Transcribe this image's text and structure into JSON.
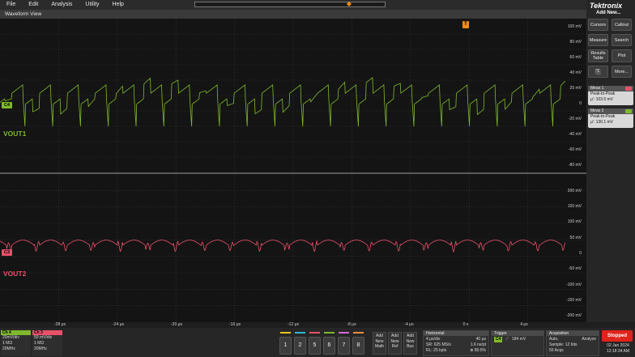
{
  "menu": [
    "File",
    "Edit",
    "Analysis",
    "Utility",
    "Help"
  ],
  "waveform_view_title": "Waveform View",
  "trigger_marker": "T",
  "brand": "Tektronix",
  "add_new": "Add New...",
  "panel_buttons": [
    "Cursors",
    "Callout",
    "Measure",
    "Search",
    "Results Table",
    "Plot",
    "More..."
  ],
  "measurements": [
    {
      "title": "Meas 1",
      "type": "Peak-to-Peak",
      "value": "μ': 103.5 mV",
      "color": "#e8516a"
    },
    {
      "title": "Meas 2",
      "type": "Peak-to-Peak",
      "value": "μ': 130.1 mV",
      "color": "#7fb92d"
    }
  ],
  "channels": {
    "vout1": {
      "badge": "C4",
      "name": "VOUT1",
      "color": "#7fb92d"
    },
    "vout2": {
      "badge": "C3",
      "name": "VOUT2",
      "color": "#e8516a"
    }
  },
  "top_axis_labels": [
    "100 mV",
    "80 mV",
    "60 mV",
    "40 mV",
    "20 mV",
    "0",
    "-20 mV",
    "-40 mV",
    "-60 mV",
    "-80 mV"
  ],
  "bottom_axis_labels": [
    "200 mV",
    "150 mV",
    "100 mV",
    "50 mV",
    "0",
    "-50 mV",
    "-100 mV",
    "-150 mV",
    "-200 mV"
  ],
  "time_labels": [
    "-28 μs",
    "-24 μs",
    "-20 μs",
    "-16 μs",
    "-12 μs",
    "-8 μs",
    "-4 μs",
    "0 s",
    "4 μs"
  ],
  "ch4_box": {
    "title": "Ch 4",
    "lines": [
      "20mV/div",
      "1 MΩ",
      "20MHz"
    ],
    "extra": "B̅"
  },
  "ch3_box": {
    "title": "Ch 3",
    "lines": [
      "50 mV/div",
      "1 MΩ",
      "20MHz"
    ],
    "extra": "B̅"
  },
  "number_buttons": [
    "1",
    "2",
    "5",
    "6",
    "7",
    "8"
  ],
  "number_colors": [
    "#e6c619",
    "#2fb5d6",
    "#e8516a",
    "#7fb92d",
    "#d16ad6",
    "#e89140"
  ],
  "add_buttons": [
    {
      "lines": [
        "Add",
        "New",
        "Math"
      ]
    },
    {
      "lines": [
        "Add",
        "New",
        "Ref"
      ]
    },
    {
      "lines": [
        "Add",
        "New",
        "Bus"
      ]
    }
  ],
  "horizontal": {
    "title": "Horizontal",
    "rows": [
      [
        "4 μs/div",
        "40 μs"
      ],
      [
        "SR: 625 MS/s",
        "1.6 ns/pt"
      ],
      [
        "RL: 25 kpts",
        "⊕ 80.5%"
      ]
    ]
  },
  "trigger": {
    "title": "Trigger",
    "badge": "C4",
    "level": "184 mV"
  },
  "acquisition": {
    "title": "Acquisition",
    "rows": [
      [
        "Auto,",
        "Analyze"
      ],
      [
        "Sample: 12 bits",
        ""
      ],
      [
        "55 Acqs",
        ""
      ]
    ]
  },
  "stop_label": "Stopped",
  "date": "02 Jan 2024",
  "time": "12:18:34 AM"
}
